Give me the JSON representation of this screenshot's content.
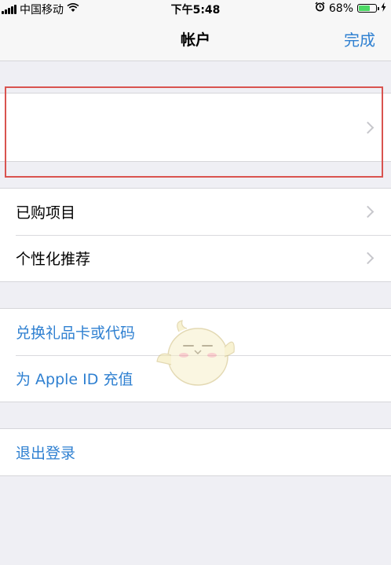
{
  "status_bar": {
    "carrier": "中国移动",
    "time": "下午5:48",
    "battery": "68%",
    "battery_level": 0.68,
    "icons": [
      "signal-icon",
      "wifi-icon",
      "alarm-icon",
      "battery-icon",
      "charging-icon"
    ]
  },
  "nav": {
    "title": "帐户",
    "done_label": "完成"
  },
  "account_row": {
    "label": ""
  },
  "section_purchases": {
    "items": [
      {
        "label": "已购项目"
      },
      {
        "label": "个性化推荐"
      }
    ]
  },
  "section_redeem": {
    "items": [
      {
        "label": "兑换礼品卡或代码"
      },
      {
        "label": "为 Apple ID 充值"
      }
    ]
  },
  "section_signout": {
    "label": "退出登录"
  },
  "colors": {
    "accent": "#2f80d1",
    "background": "#efeff4",
    "highlight_box": "#d9534f",
    "battery_fill": "#4cd964"
  }
}
